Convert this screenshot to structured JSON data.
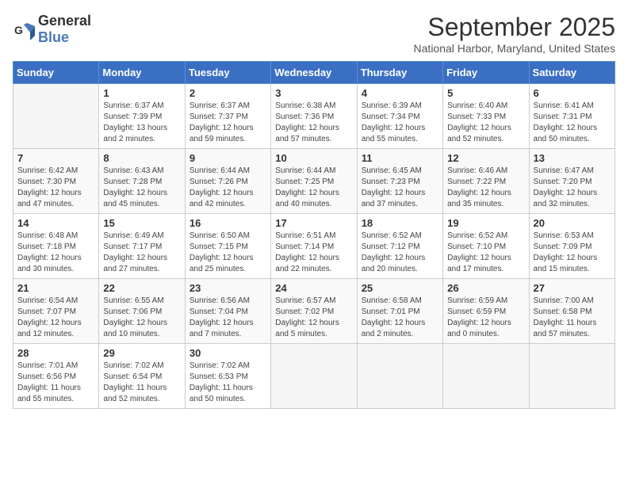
{
  "logo": {
    "general": "General",
    "blue": "Blue"
  },
  "header": {
    "month": "September 2025",
    "location": "National Harbor, Maryland, United States"
  },
  "weekdays": [
    "Sunday",
    "Monday",
    "Tuesday",
    "Wednesday",
    "Thursday",
    "Friday",
    "Saturday"
  ],
  "weeks": [
    [
      {
        "day": "",
        "sunrise": "",
        "sunset": "",
        "daylight": ""
      },
      {
        "day": "1",
        "sunrise": "Sunrise: 6:37 AM",
        "sunset": "Sunset: 7:39 PM",
        "daylight": "Daylight: 13 hours and 2 minutes."
      },
      {
        "day": "2",
        "sunrise": "Sunrise: 6:37 AM",
        "sunset": "Sunset: 7:37 PM",
        "daylight": "Daylight: 12 hours and 59 minutes."
      },
      {
        "day": "3",
        "sunrise": "Sunrise: 6:38 AM",
        "sunset": "Sunset: 7:36 PM",
        "daylight": "Daylight: 12 hours and 57 minutes."
      },
      {
        "day": "4",
        "sunrise": "Sunrise: 6:39 AM",
        "sunset": "Sunset: 7:34 PM",
        "daylight": "Daylight: 12 hours and 55 minutes."
      },
      {
        "day": "5",
        "sunrise": "Sunrise: 6:40 AM",
        "sunset": "Sunset: 7:33 PM",
        "daylight": "Daylight: 12 hours and 52 minutes."
      },
      {
        "day": "6",
        "sunrise": "Sunrise: 6:41 AM",
        "sunset": "Sunset: 7:31 PM",
        "daylight": "Daylight: 12 hours and 50 minutes."
      }
    ],
    [
      {
        "day": "7",
        "sunrise": "Sunrise: 6:42 AM",
        "sunset": "Sunset: 7:30 PM",
        "daylight": "Daylight: 12 hours and 47 minutes."
      },
      {
        "day": "8",
        "sunrise": "Sunrise: 6:43 AM",
        "sunset": "Sunset: 7:28 PM",
        "daylight": "Daylight: 12 hours and 45 minutes."
      },
      {
        "day": "9",
        "sunrise": "Sunrise: 6:44 AM",
        "sunset": "Sunset: 7:26 PM",
        "daylight": "Daylight: 12 hours and 42 minutes."
      },
      {
        "day": "10",
        "sunrise": "Sunrise: 6:44 AM",
        "sunset": "Sunset: 7:25 PM",
        "daylight": "Daylight: 12 hours and 40 minutes."
      },
      {
        "day": "11",
        "sunrise": "Sunrise: 6:45 AM",
        "sunset": "Sunset: 7:23 PM",
        "daylight": "Daylight: 12 hours and 37 minutes."
      },
      {
        "day": "12",
        "sunrise": "Sunrise: 6:46 AM",
        "sunset": "Sunset: 7:22 PM",
        "daylight": "Daylight: 12 hours and 35 minutes."
      },
      {
        "day": "13",
        "sunrise": "Sunrise: 6:47 AM",
        "sunset": "Sunset: 7:20 PM",
        "daylight": "Daylight: 12 hours and 32 minutes."
      }
    ],
    [
      {
        "day": "14",
        "sunrise": "Sunrise: 6:48 AM",
        "sunset": "Sunset: 7:18 PM",
        "daylight": "Daylight: 12 hours and 30 minutes."
      },
      {
        "day": "15",
        "sunrise": "Sunrise: 6:49 AM",
        "sunset": "Sunset: 7:17 PM",
        "daylight": "Daylight: 12 hours and 27 minutes."
      },
      {
        "day": "16",
        "sunrise": "Sunrise: 6:50 AM",
        "sunset": "Sunset: 7:15 PM",
        "daylight": "Daylight: 12 hours and 25 minutes."
      },
      {
        "day": "17",
        "sunrise": "Sunrise: 6:51 AM",
        "sunset": "Sunset: 7:14 PM",
        "daylight": "Daylight: 12 hours and 22 minutes."
      },
      {
        "day": "18",
        "sunrise": "Sunrise: 6:52 AM",
        "sunset": "Sunset: 7:12 PM",
        "daylight": "Daylight: 12 hours and 20 minutes."
      },
      {
        "day": "19",
        "sunrise": "Sunrise: 6:52 AM",
        "sunset": "Sunset: 7:10 PM",
        "daylight": "Daylight: 12 hours and 17 minutes."
      },
      {
        "day": "20",
        "sunrise": "Sunrise: 6:53 AM",
        "sunset": "Sunset: 7:09 PM",
        "daylight": "Daylight: 12 hours and 15 minutes."
      }
    ],
    [
      {
        "day": "21",
        "sunrise": "Sunrise: 6:54 AM",
        "sunset": "Sunset: 7:07 PM",
        "daylight": "Daylight: 12 hours and 12 minutes."
      },
      {
        "day": "22",
        "sunrise": "Sunrise: 6:55 AM",
        "sunset": "Sunset: 7:06 PM",
        "daylight": "Daylight: 12 hours and 10 minutes."
      },
      {
        "day": "23",
        "sunrise": "Sunrise: 6:56 AM",
        "sunset": "Sunset: 7:04 PM",
        "daylight": "Daylight: 12 hours and 7 minutes."
      },
      {
        "day": "24",
        "sunrise": "Sunrise: 6:57 AM",
        "sunset": "Sunset: 7:02 PM",
        "daylight": "Daylight: 12 hours and 5 minutes."
      },
      {
        "day": "25",
        "sunrise": "Sunrise: 6:58 AM",
        "sunset": "Sunset: 7:01 PM",
        "daylight": "Daylight: 12 hours and 2 minutes."
      },
      {
        "day": "26",
        "sunrise": "Sunrise: 6:59 AM",
        "sunset": "Sunset: 6:59 PM",
        "daylight": "Daylight: 12 hours and 0 minutes."
      },
      {
        "day": "27",
        "sunrise": "Sunrise: 7:00 AM",
        "sunset": "Sunset: 6:58 PM",
        "daylight": "Daylight: 11 hours and 57 minutes."
      }
    ],
    [
      {
        "day": "28",
        "sunrise": "Sunrise: 7:01 AM",
        "sunset": "Sunset: 6:56 PM",
        "daylight": "Daylight: 11 hours and 55 minutes."
      },
      {
        "day": "29",
        "sunrise": "Sunrise: 7:02 AM",
        "sunset": "Sunset: 6:54 PM",
        "daylight": "Daylight: 11 hours and 52 minutes."
      },
      {
        "day": "30",
        "sunrise": "Sunrise: 7:02 AM",
        "sunset": "Sunset: 6:53 PM",
        "daylight": "Daylight: 11 hours and 50 minutes."
      },
      {
        "day": "",
        "sunrise": "",
        "sunset": "",
        "daylight": ""
      },
      {
        "day": "",
        "sunrise": "",
        "sunset": "",
        "daylight": ""
      },
      {
        "day": "",
        "sunrise": "",
        "sunset": "",
        "daylight": ""
      },
      {
        "day": "",
        "sunrise": "",
        "sunset": "",
        "daylight": ""
      }
    ]
  ]
}
